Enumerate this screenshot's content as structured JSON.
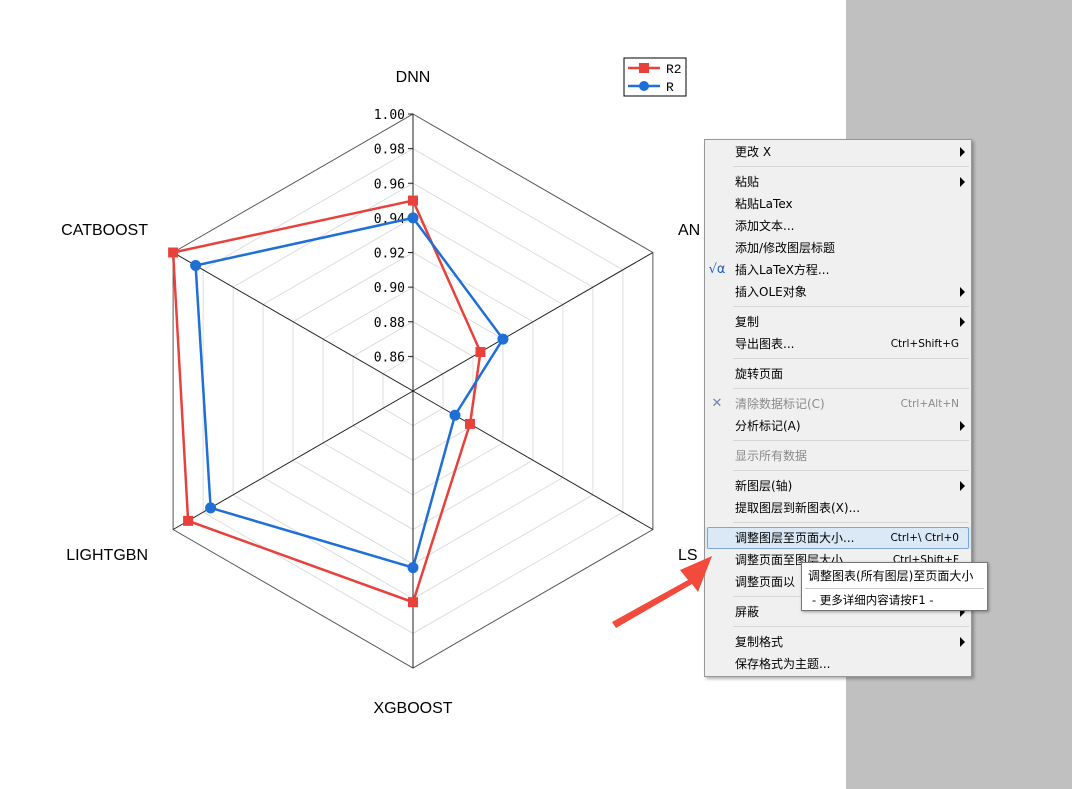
{
  "chart_data": {
    "type": "radar",
    "axes": [
      "DNN",
      "AN",
      "LS",
      "XGBOOST",
      "LIGHTGBN",
      "CATBOOST"
    ],
    "rlim": [
      0.84,
      1.0
    ],
    "ticks": [
      "1.00",
      "0.98",
      "0.96",
      "0.94",
      "0.92",
      "0.90",
      "0.88",
      "0.86"
    ],
    "series": [
      {
        "name": "R2",
        "color": "#e8413c",
        "marker": "square",
        "values": [
          0.95,
          0.885,
          0.878,
          0.962,
          0.99,
          1.0
        ]
      },
      {
        "name": "R",
        "color": "#1f6fd6",
        "marker": "circle",
        "values": [
          0.94,
          0.9,
          0.868,
          0.942,
          0.975,
          0.985
        ]
      }
    ]
  },
  "context_menu": {
    "items": [
      {
        "kind": "item",
        "label": "更改 X",
        "arrow": true
      },
      {
        "kind": "sep"
      },
      {
        "kind": "item",
        "label": "粘贴",
        "arrow": true
      },
      {
        "kind": "item",
        "label": "粘贴LaTex"
      },
      {
        "kind": "item",
        "label": "添加文本..."
      },
      {
        "kind": "item",
        "label": "添加/修改图层标题"
      },
      {
        "kind": "item",
        "label": "插入LaTeX方程...",
        "icon": "√α",
        "icon_name": "sqrt-alpha-icon",
        "icon_color": "#1f5fc6"
      },
      {
        "kind": "item",
        "label": "插入OLE对象",
        "arrow": true
      },
      {
        "kind": "sep"
      },
      {
        "kind": "item",
        "label": "复制",
        "arrow": true
      },
      {
        "kind": "item",
        "label": "导出图表...",
        "shortcut": "Ctrl+Shift+G"
      },
      {
        "kind": "sep"
      },
      {
        "kind": "item",
        "label": "旋转页面"
      },
      {
        "kind": "sep"
      },
      {
        "kind": "item",
        "label": "清除数据标记(C)",
        "shortcut": "Ctrl+Alt+N",
        "disabled": true,
        "icon": "✕",
        "icon_name": "clear-marker-icon",
        "icon_color": "#6f86a8"
      },
      {
        "kind": "item",
        "label": "分析标记(A)",
        "arrow": true
      },
      {
        "kind": "sep"
      },
      {
        "kind": "item",
        "label": "显示所有数据",
        "disabled": true
      },
      {
        "kind": "sep"
      },
      {
        "kind": "item",
        "label": "新图层(轴)",
        "arrow": true
      },
      {
        "kind": "item",
        "label": "提取图层到新图表(X)..."
      },
      {
        "kind": "sep"
      },
      {
        "kind": "item",
        "label": "调整图层至页面大小...",
        "shortcut": "Ctrl+\\ Ctrl+0",
        "highlight": true
      },
      {
        "kind": "item",
        "label": "调整页面至图层大小...",
        "shortcut": "Ctrl+Shift+F"
      },
      {
        "kind": "item",
        "label": "调整页面以"
      },
      {
        "kind": "sep"
      },
      {
        "kind": "item",
        "label": "屏蔽",
        "arrow": true
      },
      {
        "kind": "sep"
      },
      {
        "kind": "item",
        "label": "复制格式",
        "arrow": true
      },
      {
        "kind": "item",
        "label": "保存格式为主题..."
      }
    ]
  },
  "tooltip": {
    "title": "调整图表(所有图层)至页面大小",
    "hint": "- 更多详细内容请按F1 -"
  },
  "colors": {
    "arrow": "#f24a3c",
    "menu_bg": "#f0f0f0",
    "page_gray": "#c0c0c0"
  }
}
